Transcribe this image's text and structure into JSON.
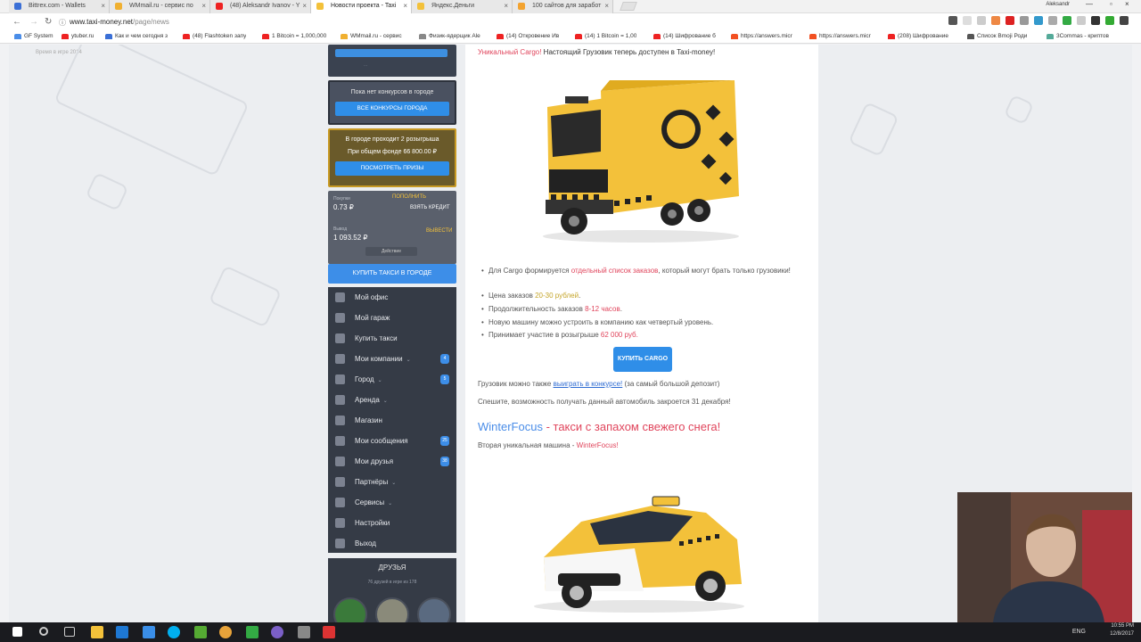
{
  "browser": {
    "tabs": [
      {
        "label": "Bittrex.com - Wallets",
        "color": "#3a6fd6"
      },
      {
        "label": "WMmail.ru - сервис по",
        "color": "#f0b030"
      },
      {
        "label": "(48) Aleksandr Ivanov - Y",
        "color": "#e22"
      },
      {
        "label": "Новости проекта - Taxi",
        "color": "#f3c13a",
        "active": true
      },
      {
        "label": "Яндекс.Деньги",
        "color": "#f3c13a"
      },
      {
        "label": "100 сайтов для заработ",
        "color": "#f3a330"
      }
    ],
    "user": "Aleksandr",
    "url_host": "www.taxi-money.net",
    "url_path": "/page/news",
    "bookmarks": [
      {
        "label": "GF System",
        "color": "#4a8de8"
      },
      {
        "label": "ytuber.ru",
        "color": "#e22"
      },
      {
        "label": "Как и чем сегодня з",
        "color": "#3a6fd6"
      },
      {
        "label": "(48) Flashtoken запу",
        "color": "#e22"
      },
      {
        "label": "1 Bitcoin = 1,000,000",
        "color": "#e22"
      },
      {
        "label": "WMmail.ru - сервис",
        "color": "#f0b030"
      },
      {
        "label": "Физик-ядерщик Ale",
        "color": "#888"
      },
      {
        "label": "(14) Откровение Ив",
        "color": "#e22"
      },
      {
        "label": "(14) 1 Bitcoin = 1,00",
        "color": "#e22"
      },
      {
        "label": "(14) Шифрование б",
        "color": "#e22"
      },
      {
        "label": "https://answers.micr",
        "color": "#f25022"
      },
      {
        "label": "https://answers.micr",
        "color": "#f25022"
      },
      {
        "label": "(208) Шифрование",
        "color": "#e22"
      },
      {
        "label": "Список Bmoji Роди",
        "color": "#555"
      },
      {
        "label": "3Commas - криптов",
        "color": "#5a9"
      }
    ]
  },
  "page": {
    "bg_note": "Время в игре 2014"
  },
  "sidebar": {
    "w0_small": "...",
    "contests": {
      "text": "Пока нет конкурсов в городе",
      "button": "ВСЕ КОНКУРСЫ ГОРОДА"
    },
    "raffles": {
      "line1": "В городе проходит 2 розыгрыша",
      "line2": "При общем фонде 66 800.00 ₽",
      "button": "ПОСМОТРЕТЬ ПРИЗЫ"
    },
    "balance": {
      "label1": "Покупки",
      "value1": "0.73 ₽",
      "link1": "ПОПОЛНИТЬ",
      "link1b": "ВЗЯТЬ КРЕДИТ",
      "label2": "Вывод",
      "value2": "1 093.52 ₽",
      "link2": "ВЫВЕСТИ",
      "select": "Действие"
    },
    "buy_taxi": "КУПИТЬ ТАКСИ В ГОРОДЕ",
    "menu": [
      {
        "label": "Мой офис",
        "icon": "home-icon"
      },
      {
        "label": "Мой гараж",
        "icon": "garage-icon"
      },
      {
        "label": "Купить такси",
        "icon": "car-icon"
      },
      {
        "label": "Мои компании",
        "icon": "briefcase-icon",
        "chev": true,
        "badge": "4"
      },
      {
        "label": "Город",
        "icon": "globe-icon",
        "chev": true,
        "badge": "5"
      },
      {
        "label": "Аренда",
        "icon": "key-icon",
        "chev": true
      },
      {
        "label": "Магазин",
        "icon": "cart-icon"
      },
      {
        "label": "Мои сообщения",
        "icon": "mail-icon",
        "badge": "25"
      },
      {
        "label": "Мои друзья",
        "icon": "user-icon",
        "badge": "38"
      },
      {
        "label": "Партнёры",
        "icon": "partners-icon",
        "chev": true
      },
      {
        "label": "Сервисы",
        "icon": "tools-icon",
        "chev": true
      },
      {
        "label": "Настройки",
        "icon": "gear-icon"
      },
      {
        "label": "Выход",
        "icon": "logout-icon"
      }
    ],
    "friends": {
      "title": "ДРУЗЬЯ",
      "subtitle": "76 друзей в игре из 178"
    }
  },
  "content": {
    "intro_red": "Уникальный Cargo!",
    "intro_rest": " Настоящий Грузовик теперь доступен в Taxi-money!",
    "bullets": [
      {
        "parts": [
          {
            "t": "Для Cargo формируется "
          },
          {
            "t": "отдельный список заказов",
            "c": "red"
          },
          {
            "t": ", который могут брать только грузовики!"
          }
        ]
      },
      {
        "parts": [
          {
            "t": "Цена заказов "
          },
          {
            "t": "20-30 рублей",
            "c": "grn"
          },
          {
            "t": "."
          }
        ]
      },
      {
        "parts": [
          {
            "t": "Продолжительность заказов "
          },
          {
            "t": "8-12 часов",
            "c": "red"
          },
          {
            "t": "."
          }
        ]
      },
      {
        "parts": [
          {
            "t": "Новую машину можно устроить в компанию как четвертый уровень."
          }
        ]
      },
      {
        "parts": [
          {
            "t": "Принимает участие в розыгрыше "
          },
          {
            "t": "62 000 руб.",
            "c": "red"
          }
        ]
      }
    ],
    "buy_button": "КУПИТЬ CARGO",
    "p1_a": "Грузовик можно также ",
    "p1_link": "выиграть в конкурсе!",
    "p1_b": " (за самый большой депозит)",
    "p2": "Спешите, возможность получать данный автомобиль закроется 31 декабря!",
    "h2_name": "WinterFocus",
    "h2_rest": " - такси с запахом свежего снега!",
    "p3_a": "Вторая уникальная машина - ",
    "p3_red": "WinterFocus!"
  },
  "taskbar": {
    "lang": "ENG",
    "time": "10:55 PM",
    "date": "12/8/2017"
  },
  "colors": {
    "accent_blue": "#2f8ee8",
    "accent_red": "#e0455c",
    "taxi_yellow": "#f3c13a"
  }
}
